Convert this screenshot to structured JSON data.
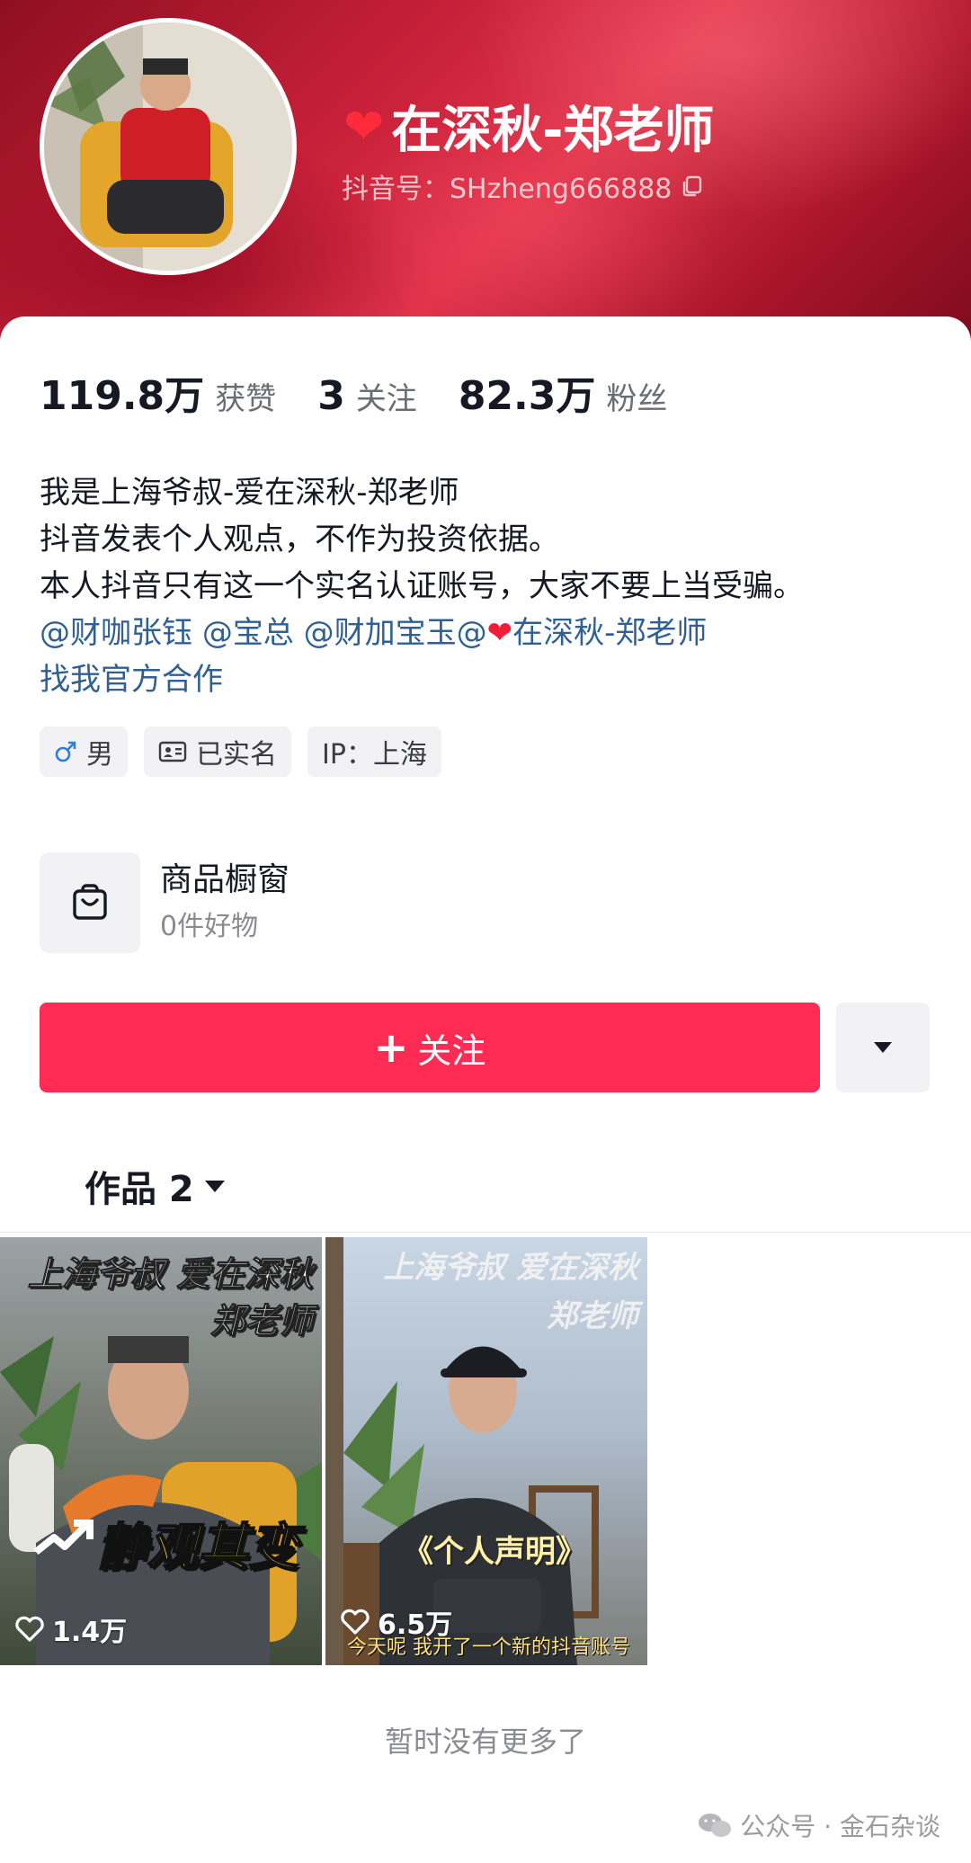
{
  "profile": {
    "name": "在深秋-郑老师",
    "douyin_id": "抖音号：SHzheng666888",
    "stats": [
      {
        "value": "119.8万",
        "label": "获赞"
      },
      {
        "value": "3",
        "label": "关注"
      },
      {
        "value": "82.3万",
        "label": "粉丝"
      }
    ],
    "bio": {
      "line1": "我是上海爷叔-爱在深秋-郑老师",
      "line2": "抖音发表个人观点，不作为投资依据。",
      "line3": "本人抖音只有这一个实名认证账号，大家不要上当受骗。",
      "mention1": "@财咖张钰",
      "mention2": "@宝总",
      "mention3": "@财加宝玉@",
      "mention4": "在深秋-郑老师",
      "link": "找我官方合作"
    },
    "tags": [
      {
        "icon": "male-icon",
        "label": "男"
      },
      {
        "icon": "id-card-icon",
        "label": "已实名"
      },
      {
        "icon": "",
        "label": "IP：上海"
      }
    ]
  },
  "shop": {
    "title": "商品橱窗",
    "subtitle": "0件好物"
  },
  "actions": {
    "follow_label": "关注",
    "more_icon": "caret-down-icon"
  },
  "works": {
    "tab_label": "作品 2",
    "items": [
      {
        "title_line1": "上海爷叔 爱在深秋",
        "title_line2": "郑老师",
        "caption": "静观其变",
        "likes": "1.4万"
      },
      {
        "title_line1": "上海爷叔 爱在深秋",
        "title_line2": "郑老师",
        "caption": "《个人声明》",
        "subtitle": "今天呢 我开了一个新的抖音账号",
        "likes": "6.5万"
      }
    ],
    "end_text": "暂时没有更多了"
  },
  "watermark": "公众号 · 金石杂谈",
  "colors": {
    "brand_red": "#fe2c55",
    "link_blue": "#2f5f93",
    "header_red": "#c8203a"
  }
}
